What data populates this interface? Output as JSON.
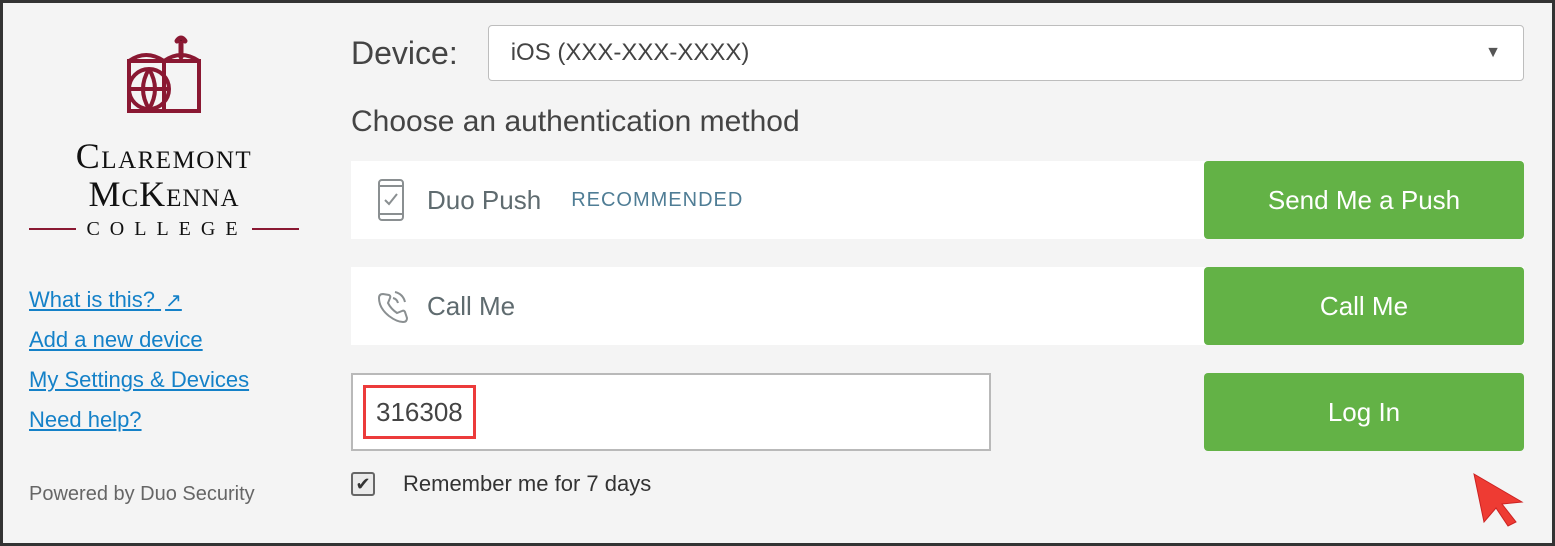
{
  "sidebar": {
    "org_line1": "Claremont",
    "org_line2": "McKenna",
    "org_college": "COLLEGE",
    "links": {
      "what_is_this": "What is this?",
      "add_device": "Add a new device",
      "my_settings": "My Settings & Devices",
      "need_help": "Need help?"
    },
    "powered": "Powered by Duo Security"
  },
  "device": {
    "label": "Device:",
    "selected": "iOS (XXX-XXX-XXXX)"
  },
  "heading": "Choose an authentication method",
  "methods": {
    "push": {
      "label": "Duo Push",
      "badge": "RECOMMENDED",
      "button": "Send Me a Push"
    },
    "call": {
      "label": "Call Me",
      "button": "Call Me"
    },
    "passcode": {
      "value": "316308",
      "button": "Log In"
    }
  },
  "remember": {
    "label": "Remember me for 7 days",
    "checked": true
  }
}
